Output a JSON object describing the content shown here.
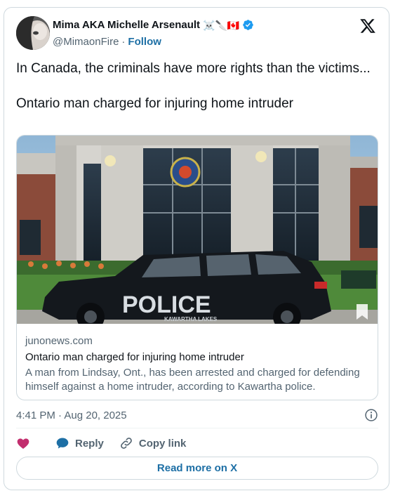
{
  "author": {
    "name": "Mima AKA Michelle Arsenault",
    "name_emojis": "☠️🔪🇨🇦",
    "handle": "@MimaonFire",
    "separator": "·",
    "follow_label": "Follow",
    "verified": true
  },
  "tweet": {
    "text": "In Canada, the criminals have more rights than the victims...\n\nOntario man charged for injuring home intruder"
  },
  "link_card": {
    "image_icon": "police-station-photo",
    "image_sign_text": "POLICE",
    "image_sub_text": "KAWARTHA LAKES",
    "domain": "junonews.com",
    "title": "Ontario man charged for injuring home intruder",
    "description": "A man from Lindsay, Ont., has been arrested and charged for defending himself against a home intruder, according to Kawartha police."
  },
  "meta": {
    "timestamp": "4:41 PM · Aug 20, 2025"
  },
  "actions": {
    "reply_label": "Reply",
    "copy_link_label": "Copy link"
  },
  "footer": {
    "read_more_label": "Read more on X"
  },
  "colors": {
    "link_blue": "#1d6fa5",
    "secondary_text": "#536471",
    "border": "#cfd9de",
    "heart_pink": "#c22e6e",
    "verified_blue": "#1d9bf0"
  }
}
